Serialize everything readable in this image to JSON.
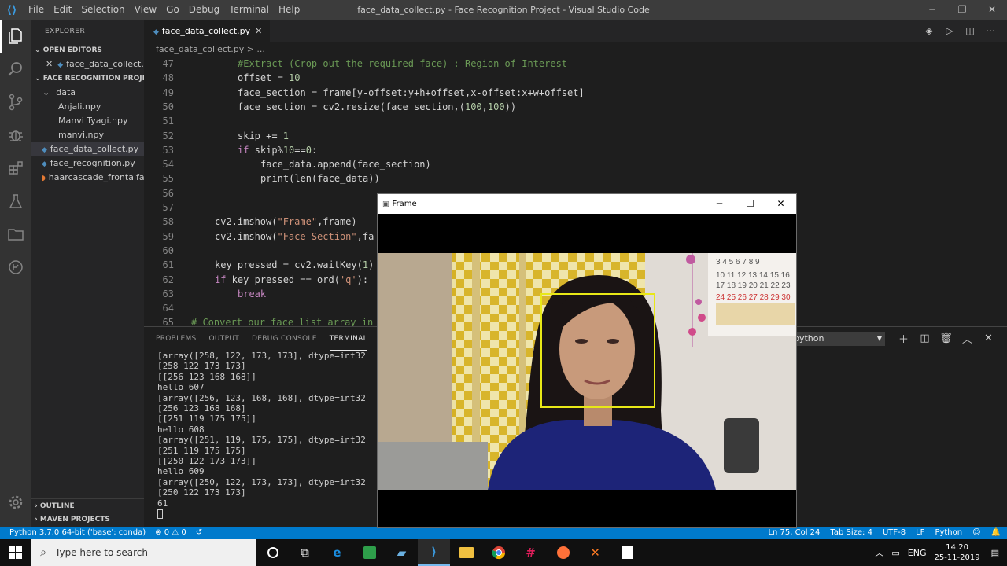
{
  "titlebar": {
    "menu": [
      "File",
      "Edit",
      "Selection",
      "View",
      "Go",
      "Debug",
      "Terminal",
      "Help"
    ],
    "window_title": "face_data_collect.py - Face Recognition Project - Visual Studio Code"
  },
  "sidebar": {
    "header": "EXPLORER",
    "open_editors": "OPEN EDITORS",
    "open_file": "face_data_collect.py",
    "project": "FACE RECOGNITION PROJE...",
    "folder": "data",
    "data_files": [
      "Anjali.npy",
      "Manvi Tyagi.npy",
      "manvi.npy"
    ],
    "files": [
      "face_data_collect.py",
      "face_recognition.py",
      "haarcascade_frontalfa..."
    ],
    "outline": "OUTLINE",
    "maven": "MAVEN PROJECTS"
  },
  "editor": {
    "tab": "face_data_collect.py",
    "breadcrumb": "face_data_collect.py > ..."
  },
  "code": {
    "ln47": "47",
    "ln48": "48",
    "ln49": "49",
    "ln50": "50",
    "ln51": "51",
    "ln52": "52",
    "ln53": "53",
    "ln54": "54",
    "ln55": "55",
    "ln56": "56",
    "ln57": "57",
    "ln58": "58",
    "ln59": "59",
    "ln60": "60",
    "ln61": "61",
    "ln62": "62",
    "ln63": "63",
    "ln64": "64",
    "ln65": "65",
    "l47": "#Extract (Crop out the required face) : Region of Interest",
    "l48a": "offset = ",
    "l48b": "10",
    "l49": "face_section = frame[y-offset:y+h+offset,x-offset:x+w+offset]",
    "l50a": "face_section = cv2.resize(face_section,(",
    "l50b": "100",
    "l50c": ",",
    "l50d": "100",
    "l50e": "))",
    "l52a": "skip += ",
    "l52b": "1",
    "l53a": "if",
    "l53b": " skip%",
    "l53c": "10",
    "l53d": "==",
    "l53e": "0",
    "l53f": ":",
    "l54": "face_data.append(face_section)",
    "l55": "print(len(face_data))",
    "l58a": "cv2.imshow(",
    "l58b": "\"Frame\"",
    "l58c": ",frame)",
    "l59a": "cv2.imshow(",
    "l59b": "\"Face Section\"",
    "l59c": ",fa",
    "l61a": "key_pressed = cv2.waitKey(",
    "l61b": "1",
    "l61c": ")",
    "l62a": "if",
    "l62b": " key_pressed == ord(",
    "l62c": "'q'",
    "l62d": "):",
    "l63": "break",
    "l65": "# Convert our face list array in"
  },
  "panel": {
    "tabs": [
      "PROBLEMS",
      "OUTPUT",
      "DEBUG CONSOLE",
      "TERMINAL"
    ],
    "shell": "python"
  },
  "terminal": {
    "lines": [
      "[array([258, 122, 173, 173], dtype=int32",
      "[258 122 173 173]",
      "[[256 123 168 168]]",
      "hello 607",
      "[array([256, 123, 168, 168], dtype=int32",
      "[256 123 168 168]",
      "[[251 119 175 175]]",
      "hello 608",
      "[array([251, 119, 175, 175], dtype=int32",
      "[251 119 175 175]",
      "[[250 122 173 173]]",
      "hello 609",
      "[array([250, 122, 173, 173], dtype=int32",
      "[250 122 173 173]",
      "61"
    ]
  },
  "statusbar": {
    "python": "Python 3.7.0 64-bit ('base': conda)",
    "problems": "⊗ 0 ⚠ 0",
    "position": "Ln 75, Col 24",
    "tabsize": "Tab Size: 4",
    "encoding": "UTF-8",
    "eol": "LF",
    "lang": "Python"
  },
  "frame": {
    "title": "Frame",
    "calendar": {
      "row1": "3 4 5 6 7 8 9",
      "row2": "10 11 12 13 14 15 16",
      "row3": "17 18 19 20 21 22 23",
      "row4": "24 25 26 27 28 29 30"
    }
  },
  "taskbar": {
    "search": "Type here to search",
    "lang": "ENG",
    "time": "14:20",
    "date": "25-11-2019"
  },
  "colors": {
    "accent": "#007acc",
    "face_box": "#e8e817"
  }
}
